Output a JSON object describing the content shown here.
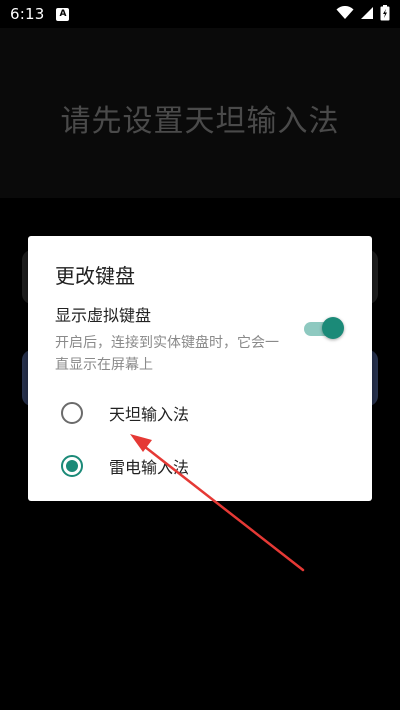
{
  "status_bar": {
    "time": "6:13",
    "a_badge": "A"
  },
  "background": {
    "title": "请先设置天坦输入法"
  },
  "dialog": {
    "title": "更改键盘",
    "show_virtual_keyboard": {
      "title": "显示虚拟键盘",
      "description": "开启后，连接到实体键盘时，它会一直显示在屏幕上",
      "enabled": true
    },
    "options": [
      {
        "label": "天坦输入法",
        "selected": false
      },
      {
        "label": "雷电输入法",
        "selected": true
      }
    ]
  },
  "colors": {
    "accent": "#1b8a78",
    "annotation_arrow": "#e53935"
  }
}
